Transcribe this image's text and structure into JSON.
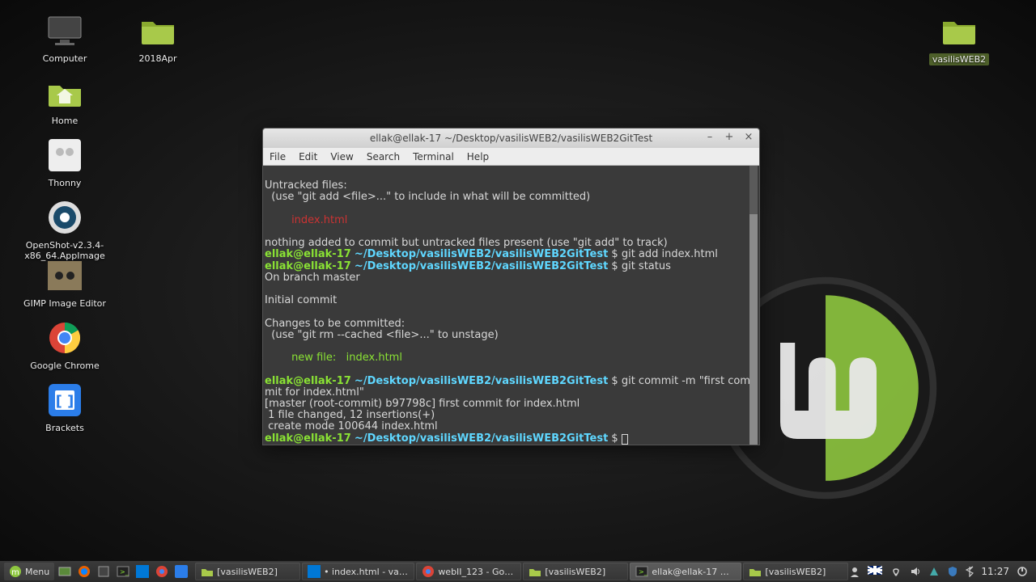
{
  "desktop_icons": {
    "computer": "Computer",
    "folder_2018apr": "2018Apr",
    "home": "Home",
    "thonny": "Thonny",
    "openshot": "OpenShot-v2.3.4-x86_64.AppImage",
    "gimp": "GIMP Image Editor",
    "chrome": "Google Chrome",
    "brackets": "Brackets",
    "vasilisweb2": "vasilisWEB2"
  },
  "terminal": {
    "title": "ellak@ellak-17 ~/Desktop/vasilisWEB2/vasilisWEB2GitTest",
    "menu": [
      "File",
      "Edit",
      "View",
      "Search",
      "Terminal",
      "Help"
    ],
    "prompt_user": "ellak@ellak-17",
    "prompt_path": "~/Desktop/vasilisWEB2/vasilisWEB2GitTest",
    "prompt_sym": "$",
    "lines": {
      "l1": "Untracked files:",
      "l2": "  (use \"git add <file>...\" to include in what will be committed)",
      "l3": "        index.html",
      "l4": "nothing added to commit but untracked files present (use \"git add\" to track)",
      "cmd1": "git add index.html",
      "cmd2": "git status",
      "l5": "On branch master",
      "l6": "Initial commit",
      "l7": "Changes to be committed:",
      "l8": "  (use \"git rm --cached <file>...\" to unstage)",
      "l9": "        new file:   index.html",
      "cmd3": "git commit -m \"first commit for index.html\"",
      "l10": "[master (root-commit) b97798c] first commit for index.html",
      "l11": " 1 file changed, 12 insertions(+)",
      "l12": " create mode 100644 index.html"
    }
  },
  "taskbar": {
    "menu": "Menu",
    "windows": {
      "w1": "[vasilisWEB2]",
      "w2": "• index.html - vas…",
      "w3": "webII_123 - Goo…",
      "w4": "[vasilisWEB2]",
      "w5": "ellak@ellak-17 ~/…",
      "w6": "[vasilisWEB2]"
    },
    "time": "11:27"
  },
  "colors": {
    "accent": "#8ae234",
    "path": "#5fd7ff"
  }
}
